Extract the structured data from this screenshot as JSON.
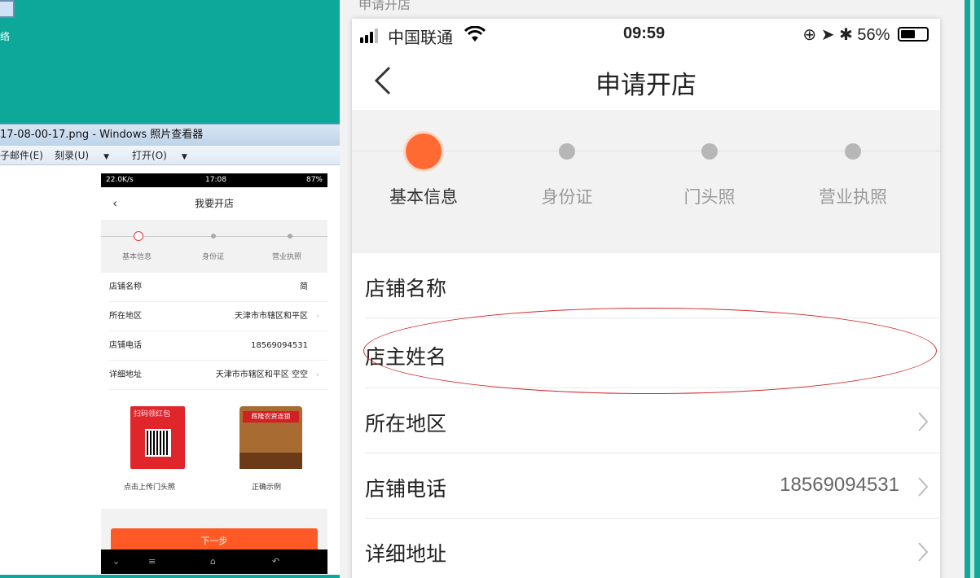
{
  "desktop": {
    "icon_label": "络",
    "viewer_title": "17-08-00-17.png - Windows 照片查看器",
    "menu": [
      "子邮件(E)",
      "刻录(U)",
      "打开(O)"
    ]
  },
  "mini_phone": {
    "status_left": "22.0K/s",
    "status_time": "17:08",
    "status_right": "87%",
    "title": "我要开店",
    "steps": [
      "基本信息",
      "身份证",
      "营业执照"
    ],
    "rows": [
      {
        "label": "店铺名称",
        "value": "简"
      },
      {
        "label": "所在地区",
        "value": "天津市市辖区和平区"
      },
      {
        "label": "店铺电话",
        "value": "18569094531"
      },
      {
        "label": "详细地址",
        "value": "天津市市辖区和平区 空空"
      }
    ],
    "red_card_title": "扫码领红包",
    "shop_banner": "辉隆农资连锁",
    "photo_captions": [
      "点击上传门头照",
      "正确示例"
    ],
    "next_button": "下一步"
  },
  "main": {
    "top_caption": "申请开店",
    "status": {
      "carrier": "中国联通",
      "time": "09:59",
      "battery": "56%",
      "battery_level": 0.56
    },
    "title": "申请开店",
    "steps": [
      {
        "label": "基本信息",
        "active": true
      },
      {
        "label": "身份证",
        "active": false
      },
      {
        "label": "门头照",
        "active": false
      },
      {
        "label": "营业执照",
        "active": false
      }
    ],
    "rows": [
      {
        "label": "店铺名称",
        "value": "",
        "chevron": false
      },
      {
        "label": "店主姓名",
        "value": "",
        "chevron": false
      },
      {
        "label": "所在地区",
        "value": "",
        "chevron": true
      },
      {
        "label": "店铺电话",
        "value": "18569094531",
        "chevron": true
      },
      {
        "label": "详细地址",
        "value": "",
        "chevron": true
      }
    ]
  },
  "colors": {
    "accent": "#ff6a33",
    "annotation": "#d0282c",
    "desktop": "#0ea89a"
  }
}
